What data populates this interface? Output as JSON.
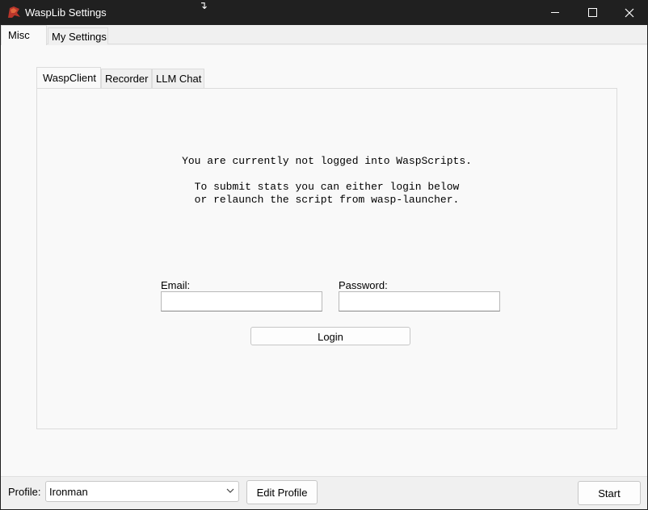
{
  "window": {
    "title": "WaspLib Settings",
    "icon": "wasplib-app-icon"
  },
  "top_tabs": [
    {
      "label": "Misc",
      "active": true
    },
    {
      "label": "My Settings",
      "active": false
    }
  ],
  "inner_tabs": [
    {
      "label": "WaspClient",
      "active": true
    },
    {
      "label": "Recorder",
      "active": false
    },
    {
      "label": "LLM Chat",
      "active": false
    }
  ],
  "waspclient": {
    "message_line1": "You are currently not logged into WaspScripts.",
    "message_line2": "To submit stats you can either login below",
    "message_line3": "or relaunch the script from wasp-launcher.",
    "email_label": "Email:",
    "email_value": "",
    "password_label": "Password:",
    "password_value": "",
    "login_label": "Login"
  },
  "bottom": {
    "profile_label": "Profile:",
    "profile_value": "Ironman",
    "edit_profile_label": "Edit Profile",
    "start_label": "Start"
  },
  "colors": {
    "titlebar": "#202020",
    "client_bg": "#f0f0f0",
    "panel_bg": "#f9f9f9",
    "border": "#dcdcdc"
  }
}
